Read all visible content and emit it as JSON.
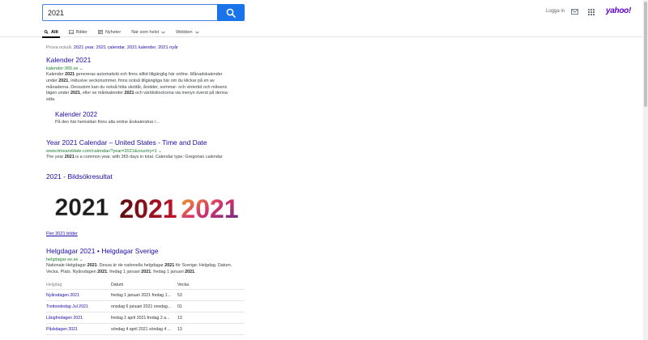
{
  "search": {
    "query": "2021"
  },
  "header": {
    "login_label": "Logga in",
    "logo": "yahoo!"
  },
  "tabs": [
    {
      "label": "Allt",
      "icon": "search-icon",
      "active": true
    },
    {
      "label": "Bilder",
      "icon": "image-icon"
    },
    {
      "label": "Nyheter",
      "icon": "news-icon"
    },
    {
      "label": "När som helst",
      "icon": "chevron-down-icon"
    },
    {
      "label": "Webben",
      "icon": "chevron-down-icon"
    }
  ],
  "also_try": {
    "prefix": "Prova också:",
    "links": [
      "2021 year",
      "2021 calendar",
      "2021 kalender",
      "2021 nyår"
    ]
  },
  "results": [
    {
      "title": "Kalender 2021",
      "url": "kalender-365.se",
      "snippet_html": "Kalender <b>2021</b> genereras automatiskt och finns alltid tillgänglig här online. Månadskalender under <b>2021</b>, inklusive veckonummer, finns också tillgängliga här om du klickar på en av månaderna. Dessutom kan du också hitta skottår, årstider, sommar- och vintertid och månens lägen under <b>2021</b>, eller se månkalender <b>2021</b> och världsklockorna via menyn överst på denna sida."
    },
    {
      "title": "Kalender 2022",
      "snippet": "På den här hemsidan finns alla online årskalendrar /..."
    },
    {
      "title": "Year 2021 Calendar – United States - Time and Date",
      "url": "www.timeanddate.com/calendar/?year=2021&country=1",
      "snippet_html": "The year <b>2021</b> is a common year, with 365 days in total. Calendar type: Gregorian calendar"
    }
  ],
  "images": {
    "heading": "2021 - Bildsökresultat",
    "tiles": [
      "2021",
      "2021",
      "2021"
    ],
    "more_label": "Fler 2021 bilder"
  },
  "holiday": {
    "title": "Helgdagar 2021 • Helgdagar Sverige",
    "url": "helgdagar-se.se",
    "snippet_html": "Nationale Helgdagar <b>2021</b>. Dessa är de nationella helgdagar <b>2021</b> för Sverige: Helgdag. Datum. Vecka. Plats. Nyårsdagen <b>2021</b>. fredag 1 januari <b>2021</b>. fredag 1 januari <b>2021</b>.",
    "table": {
      "headers": [
        "Helgdag",
        "Datum",
        "Vecka"
      ],
      "rows": [
        [
          "Nyårsdagen 2021",
          "fredag 1 januari 2021 fredag 1...",
          "53"
        ],
        [
          "Trettondedag Jul 2021",
          "onsdag 6 januari 2021 onsdag...",
          "01"
        ],
        [
          "Långfredagen 2021",
          "fredag 2 april 2021 fredag 2 a...",
          "13"
        ],
        [
          "Påskdagen 2021",
          "söndag 4 april 2021 söndag 4 ...",
          "13"
        ]
      ]
    }
  },
  "colors": {
    "link": "#1a0dab",
    "url": "#1e7d32",
    "search_button": "#1a73e8",
    "brand": "#6001d2"
  }
}
